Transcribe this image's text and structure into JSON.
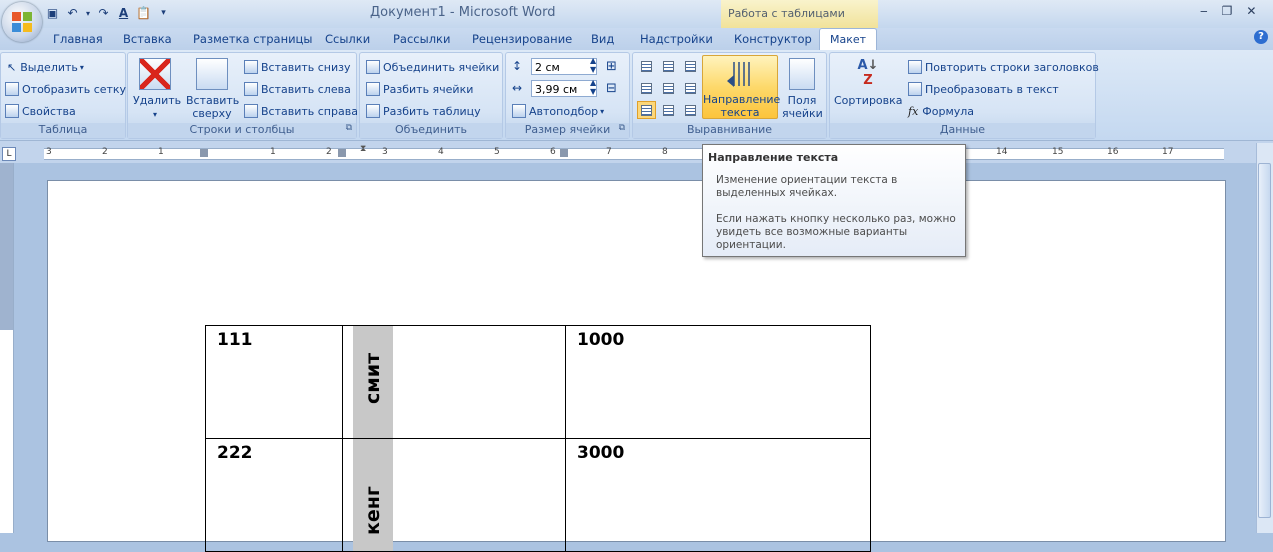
{
  "window": {
    "title": "Документ1 - Microsoft Word",
    "context_tab_title": "Работа с таблицами",
    "controls": {
      "minimize": "‒",
      "restore": "❐",
      "close": "✕"
    }
  },
  "quick_access": [
    "save-icon",
    "undo-icon",
    "redo-icon",
    "font-color-icon",
    "paste-icon",
    "dropdown-icon"
  ],
  "tabs": [
    "Главная",
    "Вставка",
    "Разметка страницы",
    "Ссылки",
    "Рассылки",
    "Рецензирование",
    "Вид",
    "Надстройки",
    "Конструктор",
    "Макет"
  ],
  "active_tab": "Макет",
  "ribbon": {
    "table": {
      "label": "Таблица",
      "select": "Выделить",
      "show_grid": "Отобразить сетку",
      "properties": "Свойства"
    },
    "rows_cols": {
      "label": "Строки и столбцы",
      "delete": "Удалить",
      "insert_above_1": "Вставить",
      "insert_above_2": "сверху",
      "insert_below": "Вставить снизу",
      "insert_left": "Вставить слева",
      "insert_right": "Вставить справа"
    },
    "merge": {
      "label": "Объединить",
      "merge_cells": "Объединить ячейки",
      "split_cells": "Разбить ячейки",
      "split_table": "Разбить таблицу"
    },
    "cell_size": {
      "label": "Размер ячейки",
      "height": "2 см",
      "width": "3,99 см",
      "autofit": "Автоподбор"
    },
    "alignment": {
      "label": "Выравнивание",
      "text_dir_1": "Направление",
      "text_dir_2": "текста",
      "margins_1": "Поля",
      "margins_2": "ячейки"
    },
    "data": {
      "label": "Данные",
      "sort": "Сортировка",
      "repeat_header": "Повторить строки заголовков",
      "convert_text": "Преобразовать в текст",
      "formula": "Формула"
    }
  },
  "ruler": {
    "corner": "L",
    "numbers": [
      "3",
      "2",
      "1",
      "1",
      "2",
      "3",
      "4",
      "5",
      "6",
      "7",
      "8",
      "14",
      "15",
      "16",
      "17"
    ]
  },
  "tooltip": {
    "title": "Направление текста",
    "line1": "Изменение ориентации текста в",
    "line2": "выделенных ячейках.",
    "line3": "Если нажать кнопку несколько раз, можно",
    "line4": "увидеть все возможные варианты",
    "line5": "ориентации."
  },
  "table_rows": [
    {
      "c1": "111",
      "c2": "смит",
      "c3": "1000"
    },
    {
      "c1": "222",
      "c2": "кенг",
      "c3": "3000"
    }
  ]
}
